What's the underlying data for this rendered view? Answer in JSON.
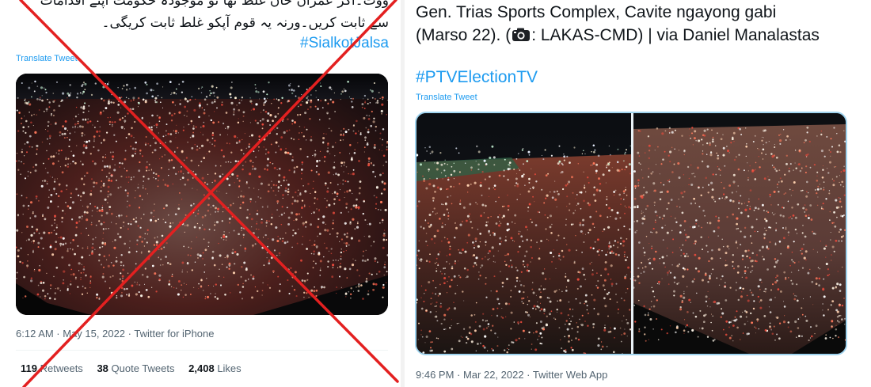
{
  "left_tweet": {
    "text_line_1": "ووٹ۔اگر عمران خان غلط تھا تو موجودہ حکومت اپنے اقدامات",
    "text_line_2": "سے ثابت کریں۔ورنہ یہ قوم آپکو غلط ثابت کریگی۔",
    "hashtag": "#SialkotJalsa",
    "translate_label": "Translate Tweet",
    "meta": "6:12 AM · May 15, 2022 · Twitter for iPhone",
    "stats": {
      "retweets_count": "119",
      "retweets_label": "Retweets",
      "quote_tweets_count": "38",
      "quote_tweets_label": "Quote Tweets",
      "likes_count": "2,408",
      "likes_label": "Likes"
    },
    "overlay": {
      "type": "red-x-mark",
      "color": "#e32020"
    }
  },
  "right_tweet": {
    "text_line_1": "Gen. Trias Sports Complex, Cavite ngayong gabi",
    "text_line_2_before_icon": "(Marso 22). (",
    "camera_icon": "camera-icon",
    "text_line_2_after_icon": ": LAKAS-CMD) | via Daniel Manalastas",
    "hashtag": "#PTVElectionTV",
    "translate_label": "Translate Tweet",
    "meta": "9:46 PM · Mar 22, 2022 · Twitter Web App"
  },
  "colors": {
    "link_blue": "#1d9bf0",
    "meta_gray": "#536471",
    "text_dark": "#0f1419",
    "media_border": "#9fd3ee"
  }
}
